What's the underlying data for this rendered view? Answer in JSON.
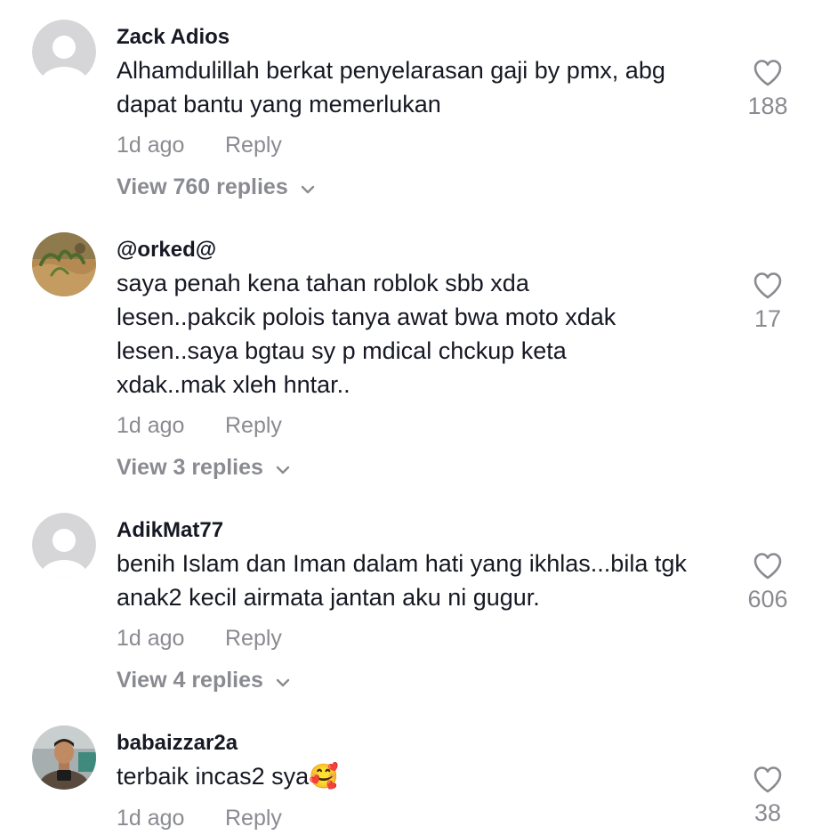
{
  "comments": [
    {
      "username": "Zack Adios",
      "text": "Alhamdulillah berkat penyelarasan gaji by pmx, abg dapat bantu yang memerlukan",
      "time": "1d ago",
      "reply_label": "Reply",
      "view_replies": "View 760 replies",
      "likes": "188",
      "avatar": "default-avatar-icon"
    },
    {
      "username": "@orked@",
      "text": "saya penah kena tahan roblok sbb xda lesen..pakcik polois tanya awat bwa moto xdak lesen..saya bgtau sy p mdical chckup keta xdak..mak xleh hntar..",
      "time": "1d ago",
      "reply_label": "Reply",
      "view_replies": "View 3 replies",
      "likes": "17",
      "avatar": "plant-photo-avatar"
    },
    {
      "username": "AdikMat77",
      "text": "benih Islam dan Iman dalam hati yang ikhlas...bila tgk anak2 kecil airmata jantan aku ni gugur.",
      "time": "1d ago",
      "reply_label": "Reply",
      "view_replies": "View 4 replies",
      "likes": "606",
      "avatar": "default-avatar-icon"
    },
    {
      "username": "babaizzar2a",
      "text": "terbaik incas2 sya🥰",
      "time": "1d ago",
      "reply_label": "Reply",
      "likes": "38",
      "avatar": "person-photo-avatar"
    }
  ],
  "colors": {
    "primary_text": "#161823",
    "secondary_text": "#8a8b91",
    "default_avatar_bg": "#d6d6d9",
    "background": "#ffffff"
  }
}
